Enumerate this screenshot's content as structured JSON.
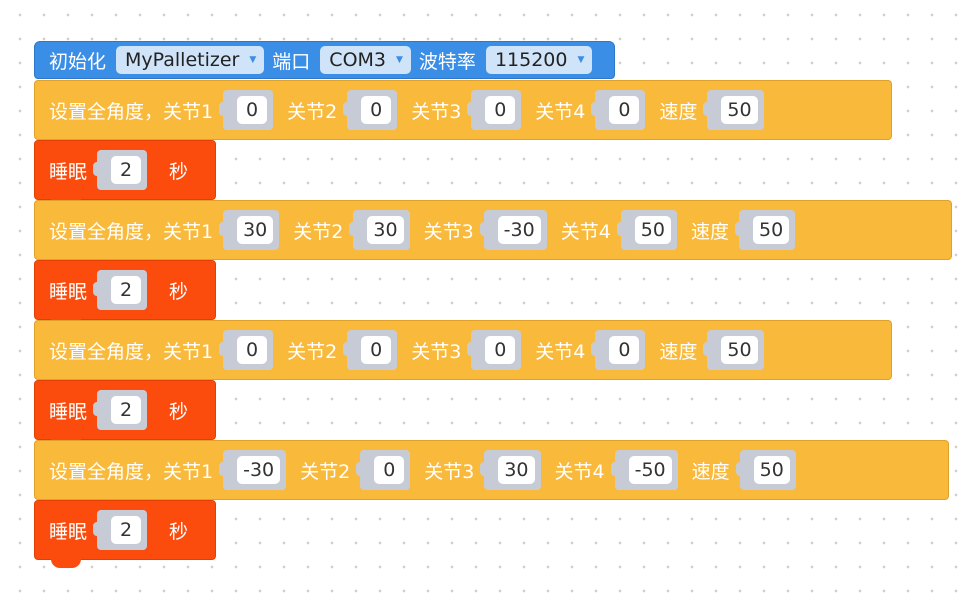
{
  "init": {
    "label": "初始化",
    "device": "MyPalletizer",
    "port_label": "端口",
    "port": "COM3",
    "baud_label": "波特率",
    "baud": "115200"
  },
  "labels": {
    "set_angles": "设置全角度，关节1",
    "joint2": "关节2",
    "joint3": "关节3",
    "joint4": "关节4",
    "speed": "速度",
    "sleep": "睡眠",
    "seconds": "秒"
  },
  "program": [
    {
      "type": "angles",
      "j1": "0",
      "j2": "0",
      "j3": "0",
      "j4": "0",
      "speed": "50"
    },
    {
      "type": "sleep",
      "value": "2"
    },
    {
      "type": "angles",
      "j1": "30",
      "j2": "30",
      "j3": "-30",
      "j4": "50",
      "speed": "50"
    },
    {
      "type": "sleep",
      "value": "2"
    },
    {
      "type": "angles",
      "j1": "0",
      "j2": "0",
      "j3": "0",
      "j4": "0",
      "speed": "50"
    },
    {
      "type": "sleep",
      "value": "2"
    },
    {
      "type": "angles",
      "j1": "-30",
      "j2": "0",
      "j3": "30",
      "j4": "-50",
      "speed": "50"
    },
    {
      "type": "sleep",
      "value": "2"
    }
  ],
  "colors": {
    "init_block": "#3a8ee6",
    "angle_block": "#f9b93b",
    "sleep_block": "#fc4c0d",
    "dropdown_bg": "#cfe4f9",
    "socket_bg": "#c7cbd6"
  }
}
